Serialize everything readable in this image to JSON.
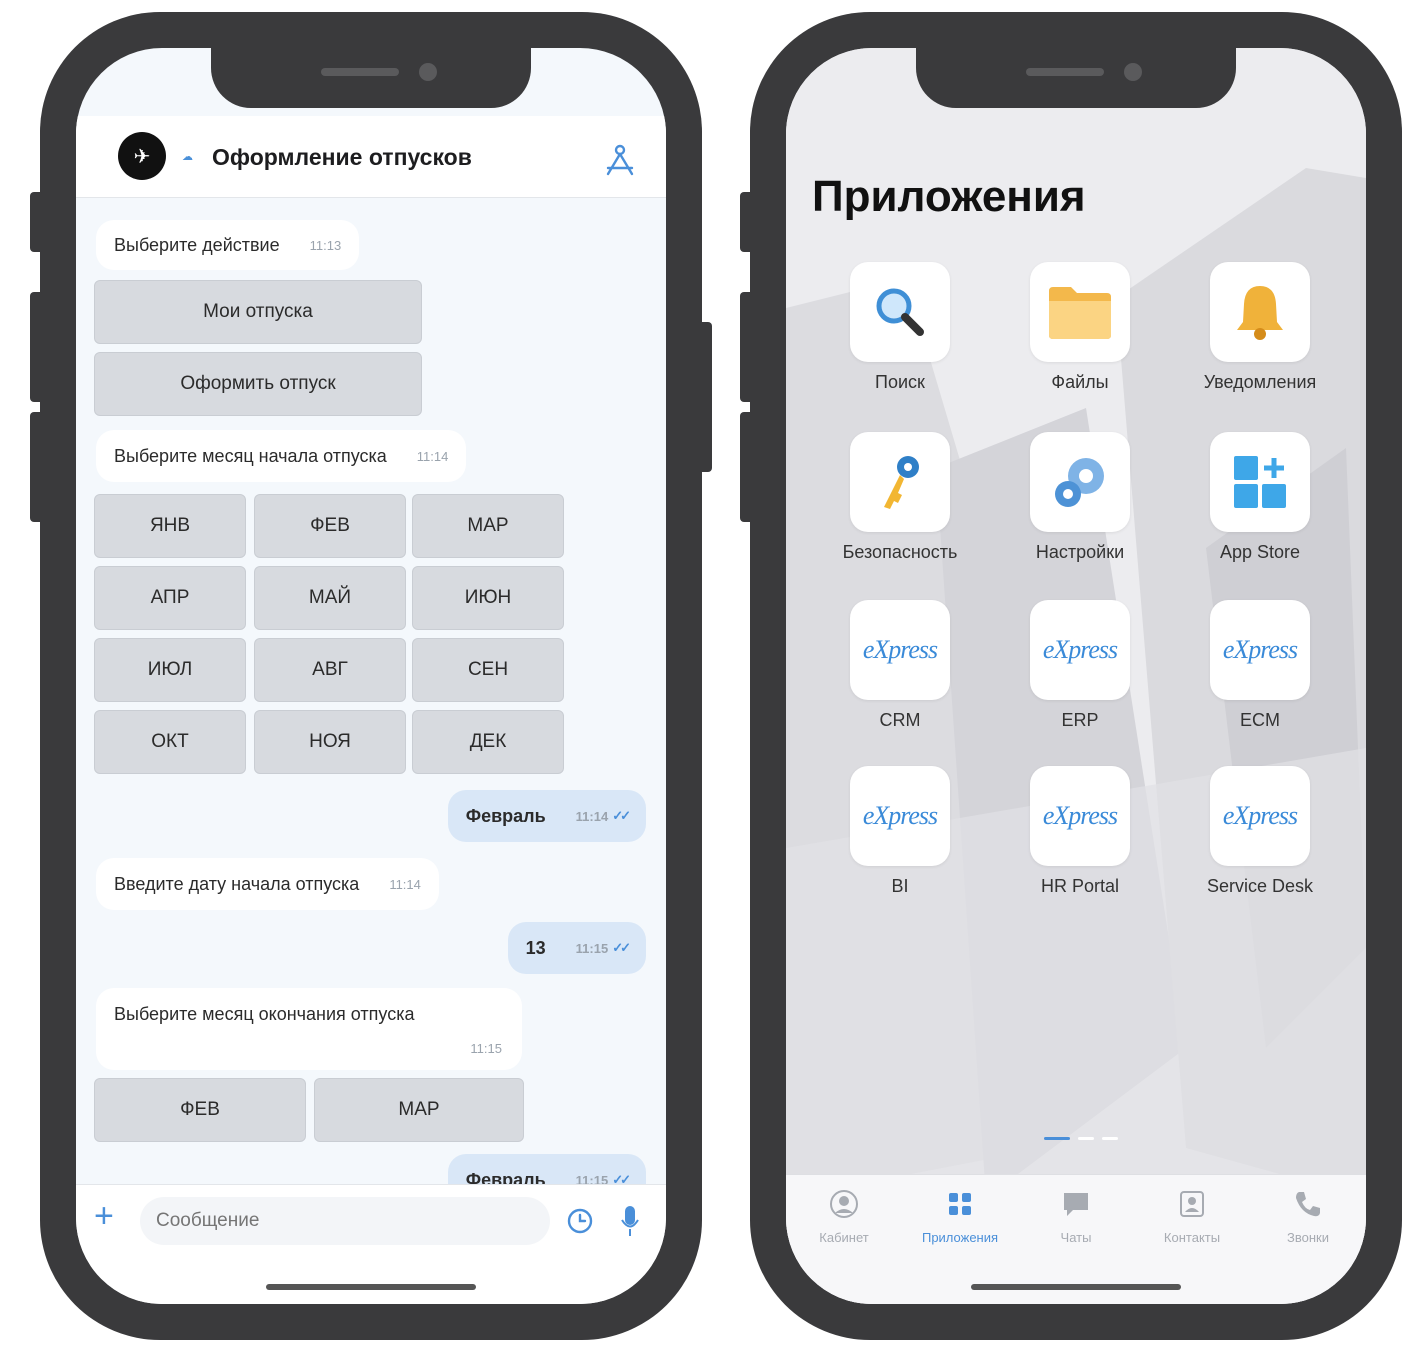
{
  "chat": {
    "title": "Оформление отпусков",
    "messages": [
      {
        "text": "Выберите действие",
        "time": "11:13"
      },
      {
        "text": "Выберите месяц начала отпуска",
        "time": "11:14"
      },
      {
        "text": "Февраль",
        "time": "11:14"
      },
      {
        "text": "Введите дату начала отпуска",
        "time": "11:14"
      },
      {
        "text": "13",
        "time": "11:15"
      },
      {
        "text": "Выберите месяц окончания отпуска",
        "time": "11:15"
      },
      {
        "text": "Февраль",
        "time": "11:15"
      }
    ],
    "action_buttons": [
      "Мои отпуска",
      "Оформить отпуск"
    ],
    "month_buttons": [
      "ЯНВ",
      "ФЕВ",
      "МАР",
      "АПР",
      "МАЙ",
      "ИЮН",
      "ИЮЛ",
      "АВГ",
      "СЕН",
      "ОКТ",
      "НОЯ",
      "ДЕК"
    ],
    "end_month_buttons": [
      "ФЕВ",
      "МАР"
    ],
    "input_placeholder": "Сообщение"
  },
  "apps": {
    "title": "Приложения",
    "items": [
      {
        "label": "Поиск",
        "icon": "search-icon"
      },
      {
        "label": "Файлы",
        "icon": "folder-icon"
      },
      {
        "label": "Уведомления",
        "icon": "bell-icon"
      },
      {
        "label": "Безопасность",
        "icon": "keys-icon"
      },
      {
        "label": "Настройки",
        "icon": "gears-icon"
      },
      {
        "label": "App Store",
        "icon": "app-store-icon"
      },
      {
        "label": "CRM",
        "icon": "express-logo-icon"
      },
      {
        "label": "ERP",
        "icon": "express-logo-icon"
      },
      {
        "label": "ECM",
        "icon": "express-logo-icon"
      },
      {
        "label": "BI",
        "icon": "express-logo-icon"
      },
      {
        "label": "HR Portal",
        "icon": "express-logo-icon"
      },
      {
        "label": "Service Desk",
        "icon": "express-logo-icon"
      }
    ],
    "express_logo": "eXpress",
    "tabs": [
      {
        "label": "Кабинет",
        "icon": "user-icon"
      },
      {
        "label": "Приложения",
        "icon": "grid-icon",
        "active": true
      },
      {
        "label": "Чаты",
        "icon": "chat-icon"
      },
      {
        "label": "Контакты",
        "icon": "contacts-icon"
      },
      {
        "label": "Звонки",
        "icon": "phone-icon"
      }
    ],
    "page_count": 3,
    "current_page": 1
  },
  "colors": {
    "accent": "#4a8fd9",
    "frame": "#3a3a3c",
    "outgoing_bubble": "#d9e7f7",
    "keyboard_button": "#d7dadf"
  }
}
